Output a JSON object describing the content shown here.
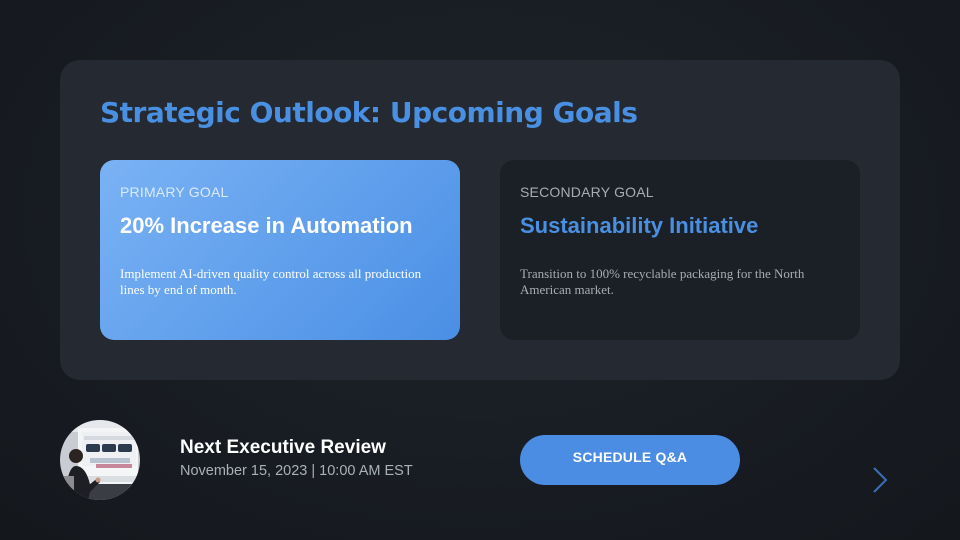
{
  "slide": {
    "title": "Strategic Outlook: Upcoming Goals"
  },
  "goals": [
    {
      "label": "PRIMARY GOAL",
      "heading": "20% Increase in Automation",
      "description": "Implement AI-driven quality control across all production lines by end of month."
    },
    {
      "label": "SECONDARY GOAL",
      "heading": "Sustainability Initiative",
      "description": "Transition to 100% recyclable packaging for the North American market."
    }
  ],
  "review": {
    "title": "Next Executive Review",
    "date": "November 15, 2023 | 10:00 AM EST"
  },
  "actions": {
    "schedule_label": "SCHEDULE Q&A"
  },
  "icons": {
    "next": "chevron-right-icon",
    "avatar": "presenter-photo"
  },
  "colors": {
    "accent": "#4a90e2",
    "background": "#171b21",
    "panel": "#252a32",
    "secondary_card": "#1b1f26"
  }
}
